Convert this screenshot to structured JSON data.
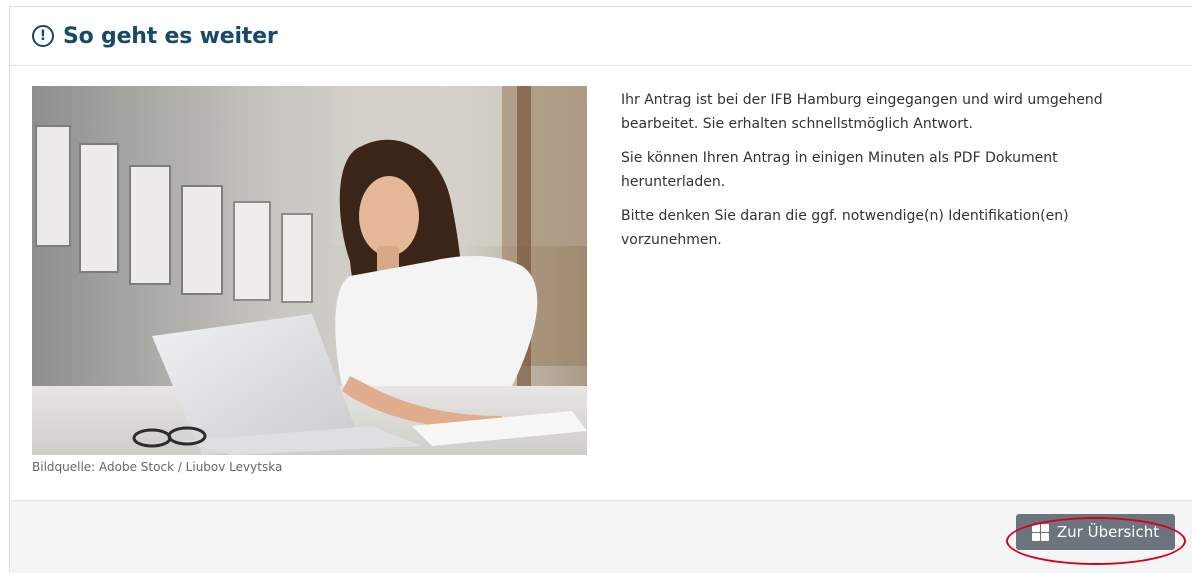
{
  "header": {
    "title": "So geht es weiter",
    "icon": "exclamation-circle-icon",
    "icon_glyph": "!"
  },
  "image": {
    "description_icon": "photo-woman-laptop",
    "caption": "Bildquelle: Adobe Stock / Liubov Levytska"
  },
  "content": {
    "paragraphs": [
      "Ihr Antrag ist bei der IFB Hamburg eingegangen und wird umgehend bearbeitet. Sie erhalten schnellstmöglich Antwort.",
      "Sie können Ihren Antrag in einigen Minuten als PDF Dokument herunterladen.",
      "Bitte denken Sie daran die ggf. notwendige(n) Identifikation(en) vorzunehmen."
    ]
  },
  "footer": {
    "overview_button_label": "Zur Übersicht",
    "overview_button_icon": "grid-icon"
  },
  "colors": {
    "title": "#17496a",
    "button_bg": "#6c757d",
    "highlight": "#d6001c",
    "footer_bg": "#f5f5f5"
  }
}
